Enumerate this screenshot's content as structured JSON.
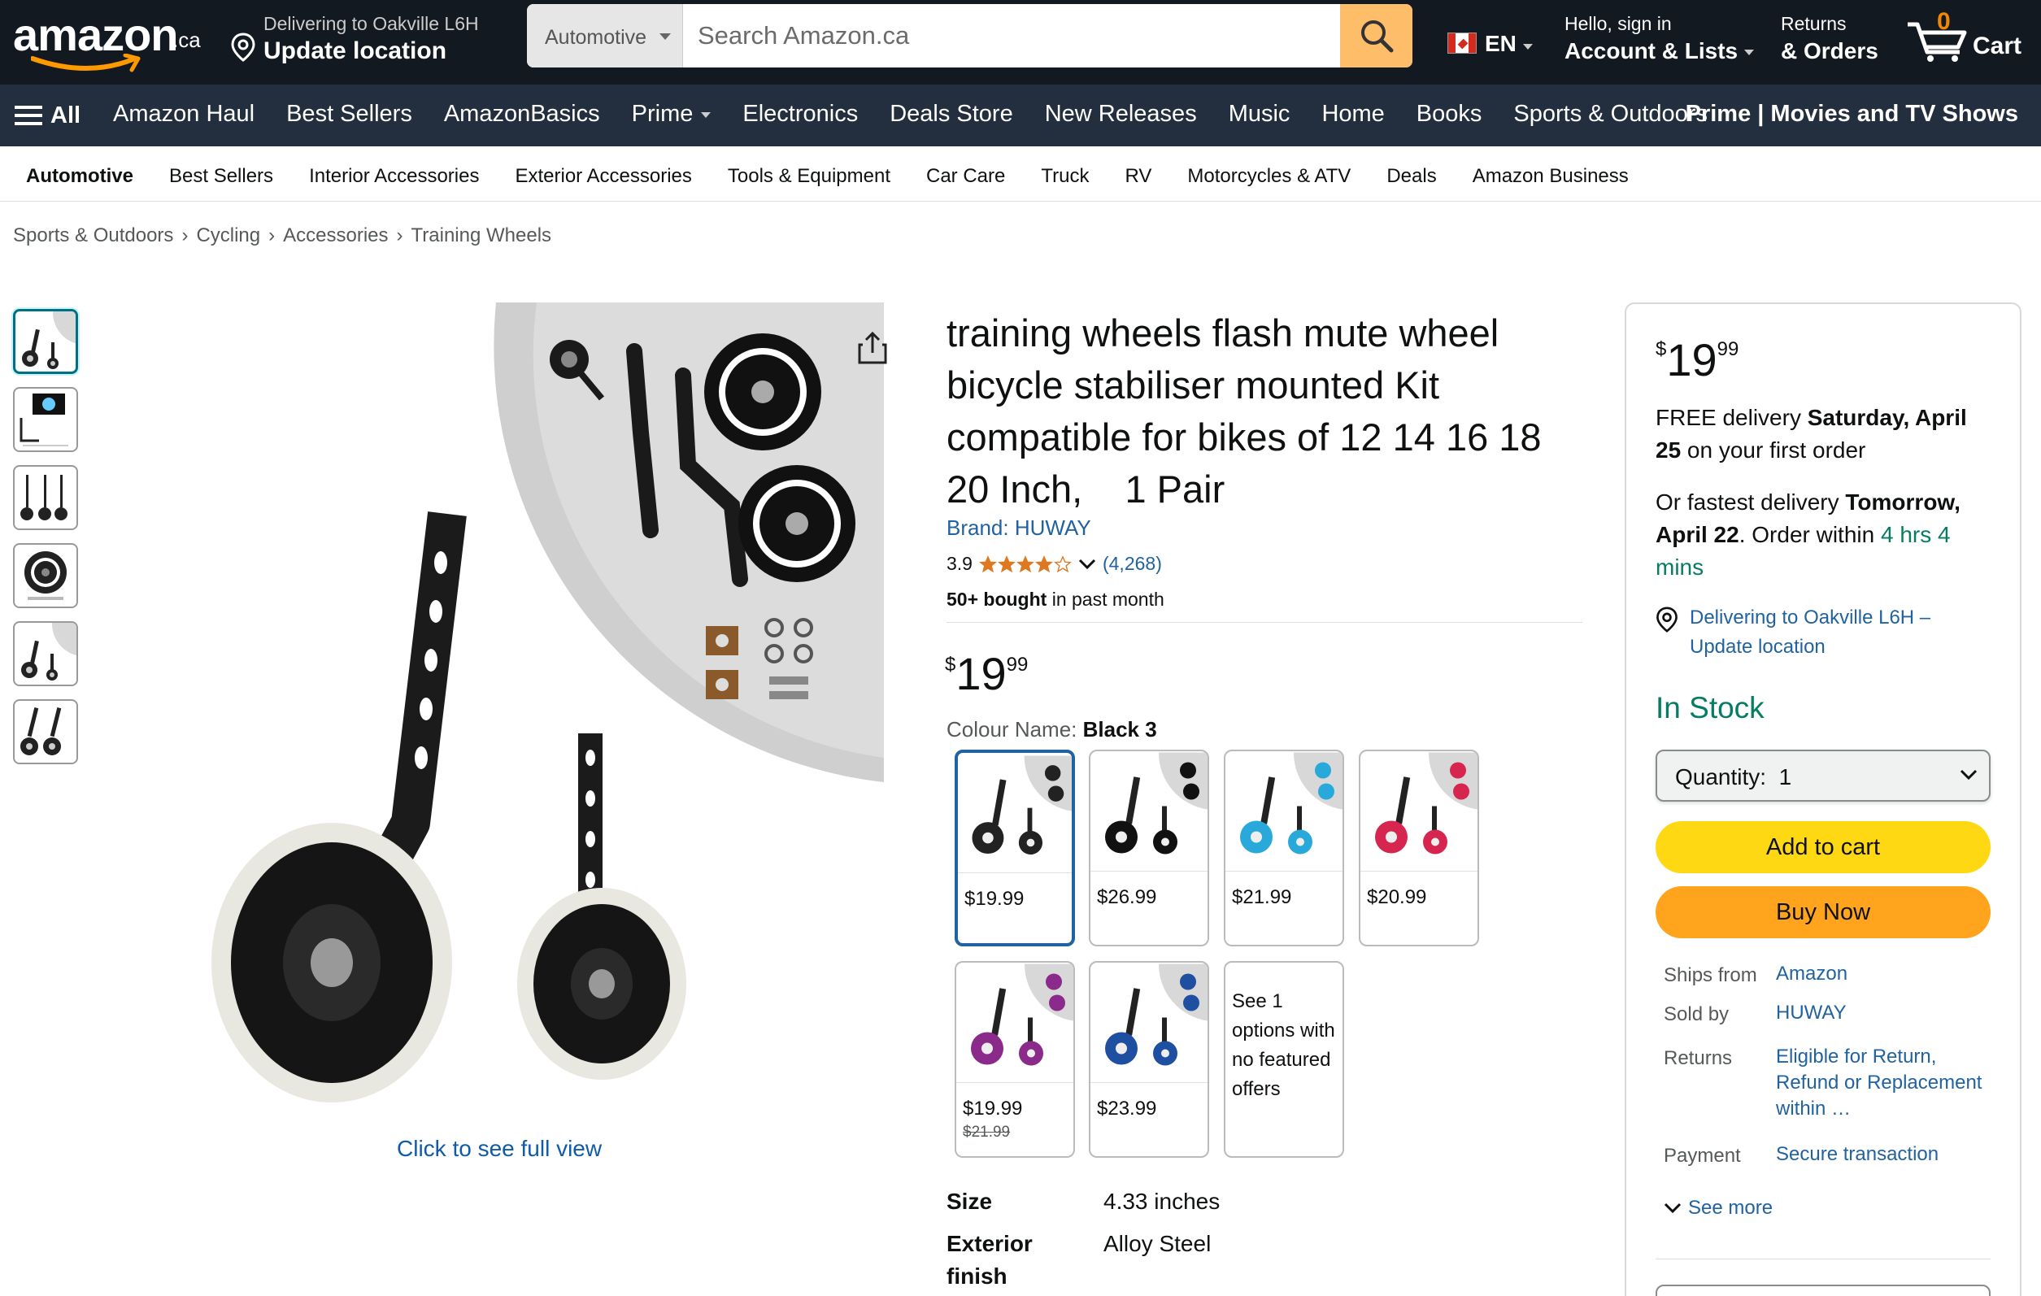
{
  "header": {
    "logo_text": "amazon",
    "logo_tld": ".ca",
    "deliver_line1": "Delivering to Oakville L6H",
    "deliver_line2": "Update location",
    "search_category": "Automotive",
    "search_placeholder": "Search Amazon.ca",
    "language": "EN",
    "account_line1": "Hello, sign in",
    "account_line2": "Account & Lists",
    "orders_line1": "Returns",
    "orders_line2": "& Orders",
    "cart_count": "0",
    "cart_label": "Cart"
  },
  "nav": {
    "all_label": "All",
    "items": [
      "Amazon Haul",
      "Best Sellers",
      "AmazonBasics",
      "Prime",
      "Electronics",
      "Deals Store",
      "New Releases",
      "Music",
      "Home",
      "Books",
      "Sports & Outdoors"
    ],
    "right_label": "Prime | Movies and TV Shows"
  },
  "subnav": {
    "items": [
      "Automotive",
      "Best Sellers",
      "Interior Accessories",
      "Exterior Accessories",
      "Tools & Equipment",
      "Car Care",
      "Truck",
      "RV",
      "Motorcycles & ATV",
      "Deals",
      "Amazon Business"
    ]
  },
  "breadcrumb": [
    "Sports & Outdoors",
    "Cycling",
    "Accessories",
    "Training Wheels"
  ],
  "gallery": {
    "full_view_label": "Click to see full view",
    "thumb_count": 6
  },
  "product": {
    "title": "training wheels flash mute wheel bicycle stabiliser mounted Kit compatible for bikes of 12 14 16 18 20 Inch,    1 Pair",
    "brand": "Brand: HUWAY",
    "rating": "3.9",
    "rating_stars": 3.9,
    "rating_count": "(4,268)",
    "bought_bold": "50+ bought",
    "bought_rest": " in past month",
    "price_symbol": "$",
    "price_whole": "19",
    "price_fraction": "99",
    "colour_label": "Colour Name: ",
    "colour_value": "Black 3",
    "swatches": [
      {
        "price": "$19.99",
        "color": "#222222"
      },
      {
        "price": "$26.99",
        "color": "#111111"
      },
      {
        "price": "$21.99",
        "color": "#29a9d9"
      },
      {
        "price": "$20.99",
        "color": "#d6264f"
      },
      {
        "price": "$19.99",
        "was": "$21.99",
        "color": "#8a2a8a"
      },
      {
        "price": "$23.99",
        "color": "#1f4fa0"
      }
    ],
    "see_options": "See 1 options with no featured offers",
    "specs": [
      {
        "key": "Size",
        "value": "4.33 inches"
      },
      {
        "key": "Exterior finish",
        "value": "Alloy Steel"
      }
    ]
  },
  "buybox": {
    "price_symbol": "$",
    "price_whole": "19",
    "price_fraction": "99",
    "free_delivery_pre": "FREE delivery ",
    "free_delivery_date": "Saturday, April 25",
    "free_delivery_post": " on your first order",
    "fast_pre": "Or fastest delivery ",
    "fast_date": "Tomorrow, April 22",
    "fast_mid": ". Order within ",
    "fast_time": "4 hrs 4 mins",
    "location": "Delivering to Oakville L6H – Update location",
    "stock": "In Stock",
    "quantity": "Quantity:  1",
    "add_to_cart": "Add to cart",
    "buy_now": "Buy Now",
    "info": [
      {
        "label": "Ships from",
        "value": "Amazon"
      },
      {
        "label": "Sold by",
        "value": "HUWAY"
      },
      {
        "label": "Returns",
        "value": "Eligible for Return, Refund or Replacement within …"
      },
      {
        "label": "Payment",
        "value": "Secure transaction"
      }
    ],
    "see_more": "See more"
  },
  "colors": {
    "header_bg": "#131921",
    "nav_bg": "#232f3e",
    "search_button": "#febd69",
    "add_to_cart": "#ffd814",
    "buy_now": "#ffa41c",
    "link": "#2162a1",
    "in_stock": "#067d62",
    "star": "#de7921"
  }
}
